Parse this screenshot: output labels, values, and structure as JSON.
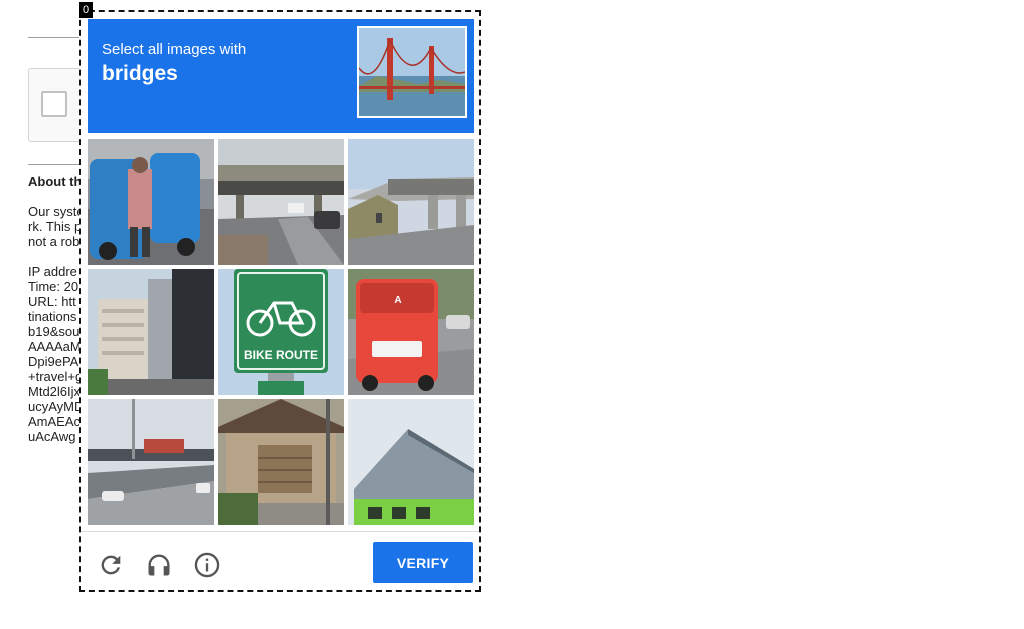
{
  "page": {
    "heading": "About th",
    "paragraph_lines": [
      "Our syste",
      "rk. This p",
      "not a robo"
    ],
    "details_lines": [
      "IP addre",
      "Time: 20",
      "URL: htt",
      "tinations",
      "b19&sou",
      "AAAAaM",
      "Dpi9ePA",
      "+travel+g",
      "Mtd2l6Ijx",
      "ucyAyMD",
      "AmAEAc",
      "uAcAwg"
    ]
  },
  "challenge": {
    "corner_tag": "0",
    "prompt": "Select all images with",
    "keyword": "bridges",
    "sample_image": "golden-gate-bridge",
    "tiles": [
      {
        "id": "tile-1",
        "content": "blue-tuk-tuk-street"
      },
      {
        "id": "tile-2",
        "content": "highway-overpass"
      },
      {
        "id": "tile-3",
        "content": "overpass-sky"
      },
      {
        "id": "tile-4",
        "content": "tall-buildings"
      },
      {
        "id": "tile-5",
        "content": "bike-route-sign"
      },
      {
        "id": "tile-6",
        "content": "red-bus"
      },
      {
        "id": "tile-7",
        "content": "elevated-highway"
      },
      {
        "id": "tile-8",
        "content": "house-garage"
      },
      {
        "id": "tile-9",
        "content": "green-building-roof"
      }
    ],
    "footer": {
      "reload_icon": "reload-icon",
      "audio_icon": "headphones-icon",
      "info_icon": "info-icon",
      "verify_label": "VERIFY"
    }
  },
  "colors": {
    "accent": "#1a73e8",
    "footer_icon": "#555555"
  }
}
